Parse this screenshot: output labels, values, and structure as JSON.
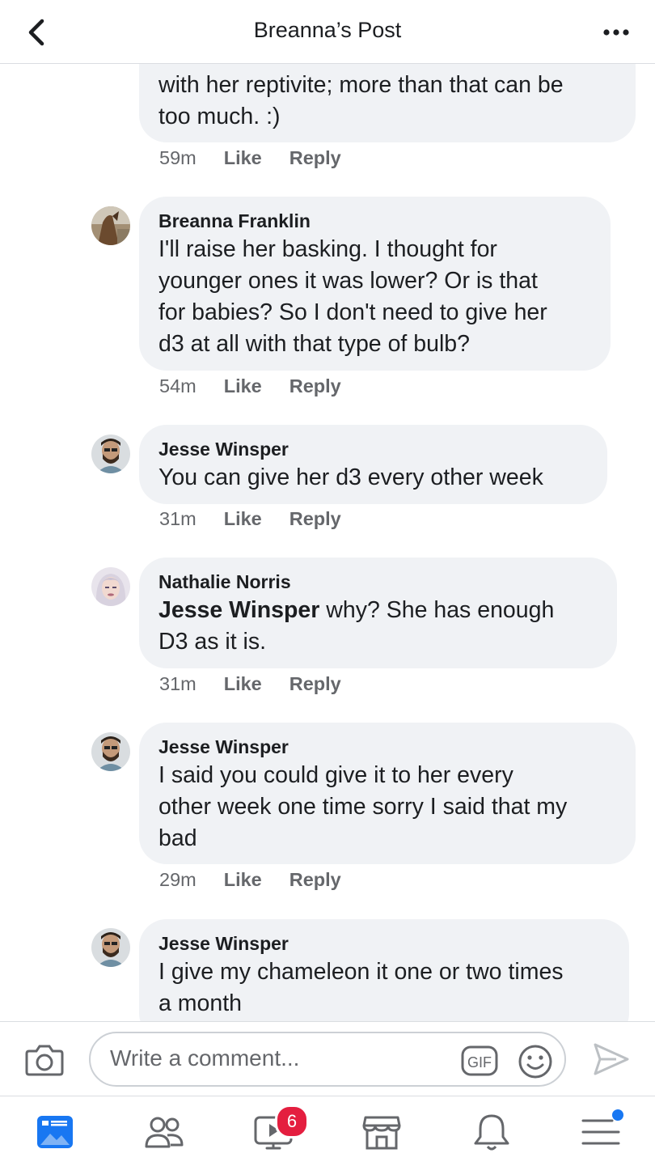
{
  "header": {
    "title": "Breanna’s Post"
  },
  "comments": [
    {
      "author": "",
      "mention": "",
      "text": "with her reptivite; more than that can be\ntoo much.  :)",
      "time": "59m",
      "like": "Like",
      "reply": "Reply"
    },
    {
      "author": "Breanna Franklin",
      "mention": "",
      "text": "I'll raise her basking. I thought for\nyounger ones it was lower? Or is that\nfor babies? So I don't need to give her\nd3 at all with that type of bulb?",
      "time": "54m",
      "like": "Like",
      "reply": "Reply"
    },
    {
      "author": "Jesse Winsper",
      "mention": "",
      "text": "You can give her d3 every other week",
      "time": "31m",
      "like": "Like",
      "reply": "Reply"
    },
    {
      "author": "Nathalie Norris",
      "mention": "Jesse Winsper",
      "text": " why?  She has enough\nD3 as it is.",
      "time": "31m",
      "like": "Like",
      "reply": "Reply"
    },
    {
      "author": "Jesse Winsper",
      "mention": "",
      "text": "I said you could give it to her every\nother week one time sorry I said that my\nbad",
      "time": "29m",
      "like": "Like",
      "reply": "Reply"
    },
    {
      "author": "Jesse Winsper",
      "mention": "",
      "text": "I give my chameleon it one or two times\na month",
      "time": "",
      "like": "",
      "reply": ""
    }
  ],
  "composer": {
    "placeholder": "Write a comment...",
    "gif_label": "GIF"
  },
  "nav": {
    "watch_badge": "6"
  },
  "icons": {
    "back": "chevron-left-icon",
    "more": "more-horizontal-icon",
    "camera": "camera-icon",
    "gif": "gif-icon",
    "emoji": "emoji-icon",
    "send": "send-icon",
    "news_feed": "news-feed-icon",
    "friends": "friends-icon",
    "watch": "watch-icon",
    "marketplace": "marketplace-icon",
    "notifications": "bell-icon",
    "menu": "menu-icon"
  },
  "colors": {
    "accent": "#1877f2",
    "badge": "#e41e3f",
    "bubble": "#f0f2f5",
    "meta": "#65676b"
  }
}
